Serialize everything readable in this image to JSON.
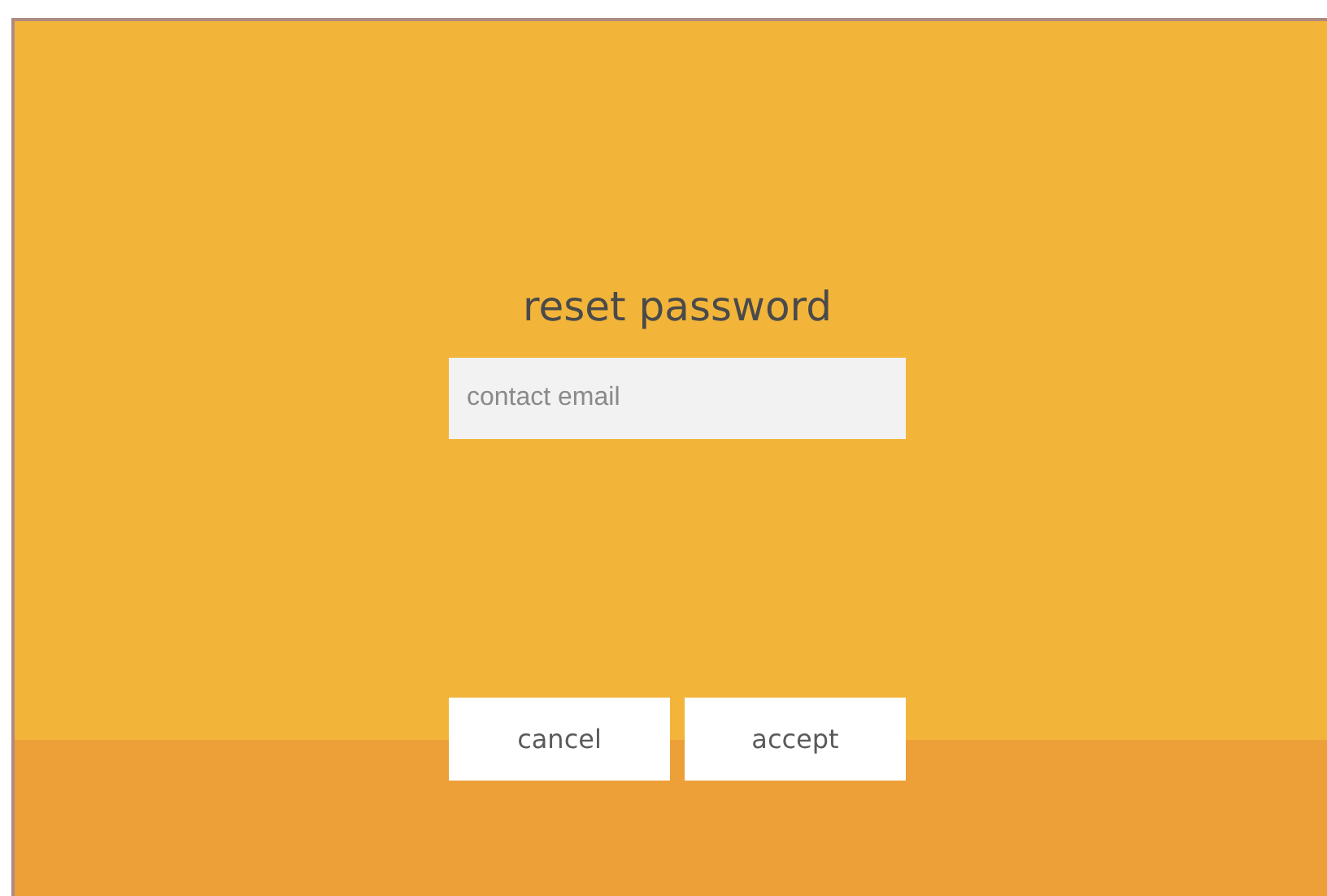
{
  "title": "reset password",
  "email": {
    "placeholder": "contact email"
  },
  "buttons": [
    {
      "label": "cancel"
    },
    {
      "label": "accept"
    }
  ]
}
